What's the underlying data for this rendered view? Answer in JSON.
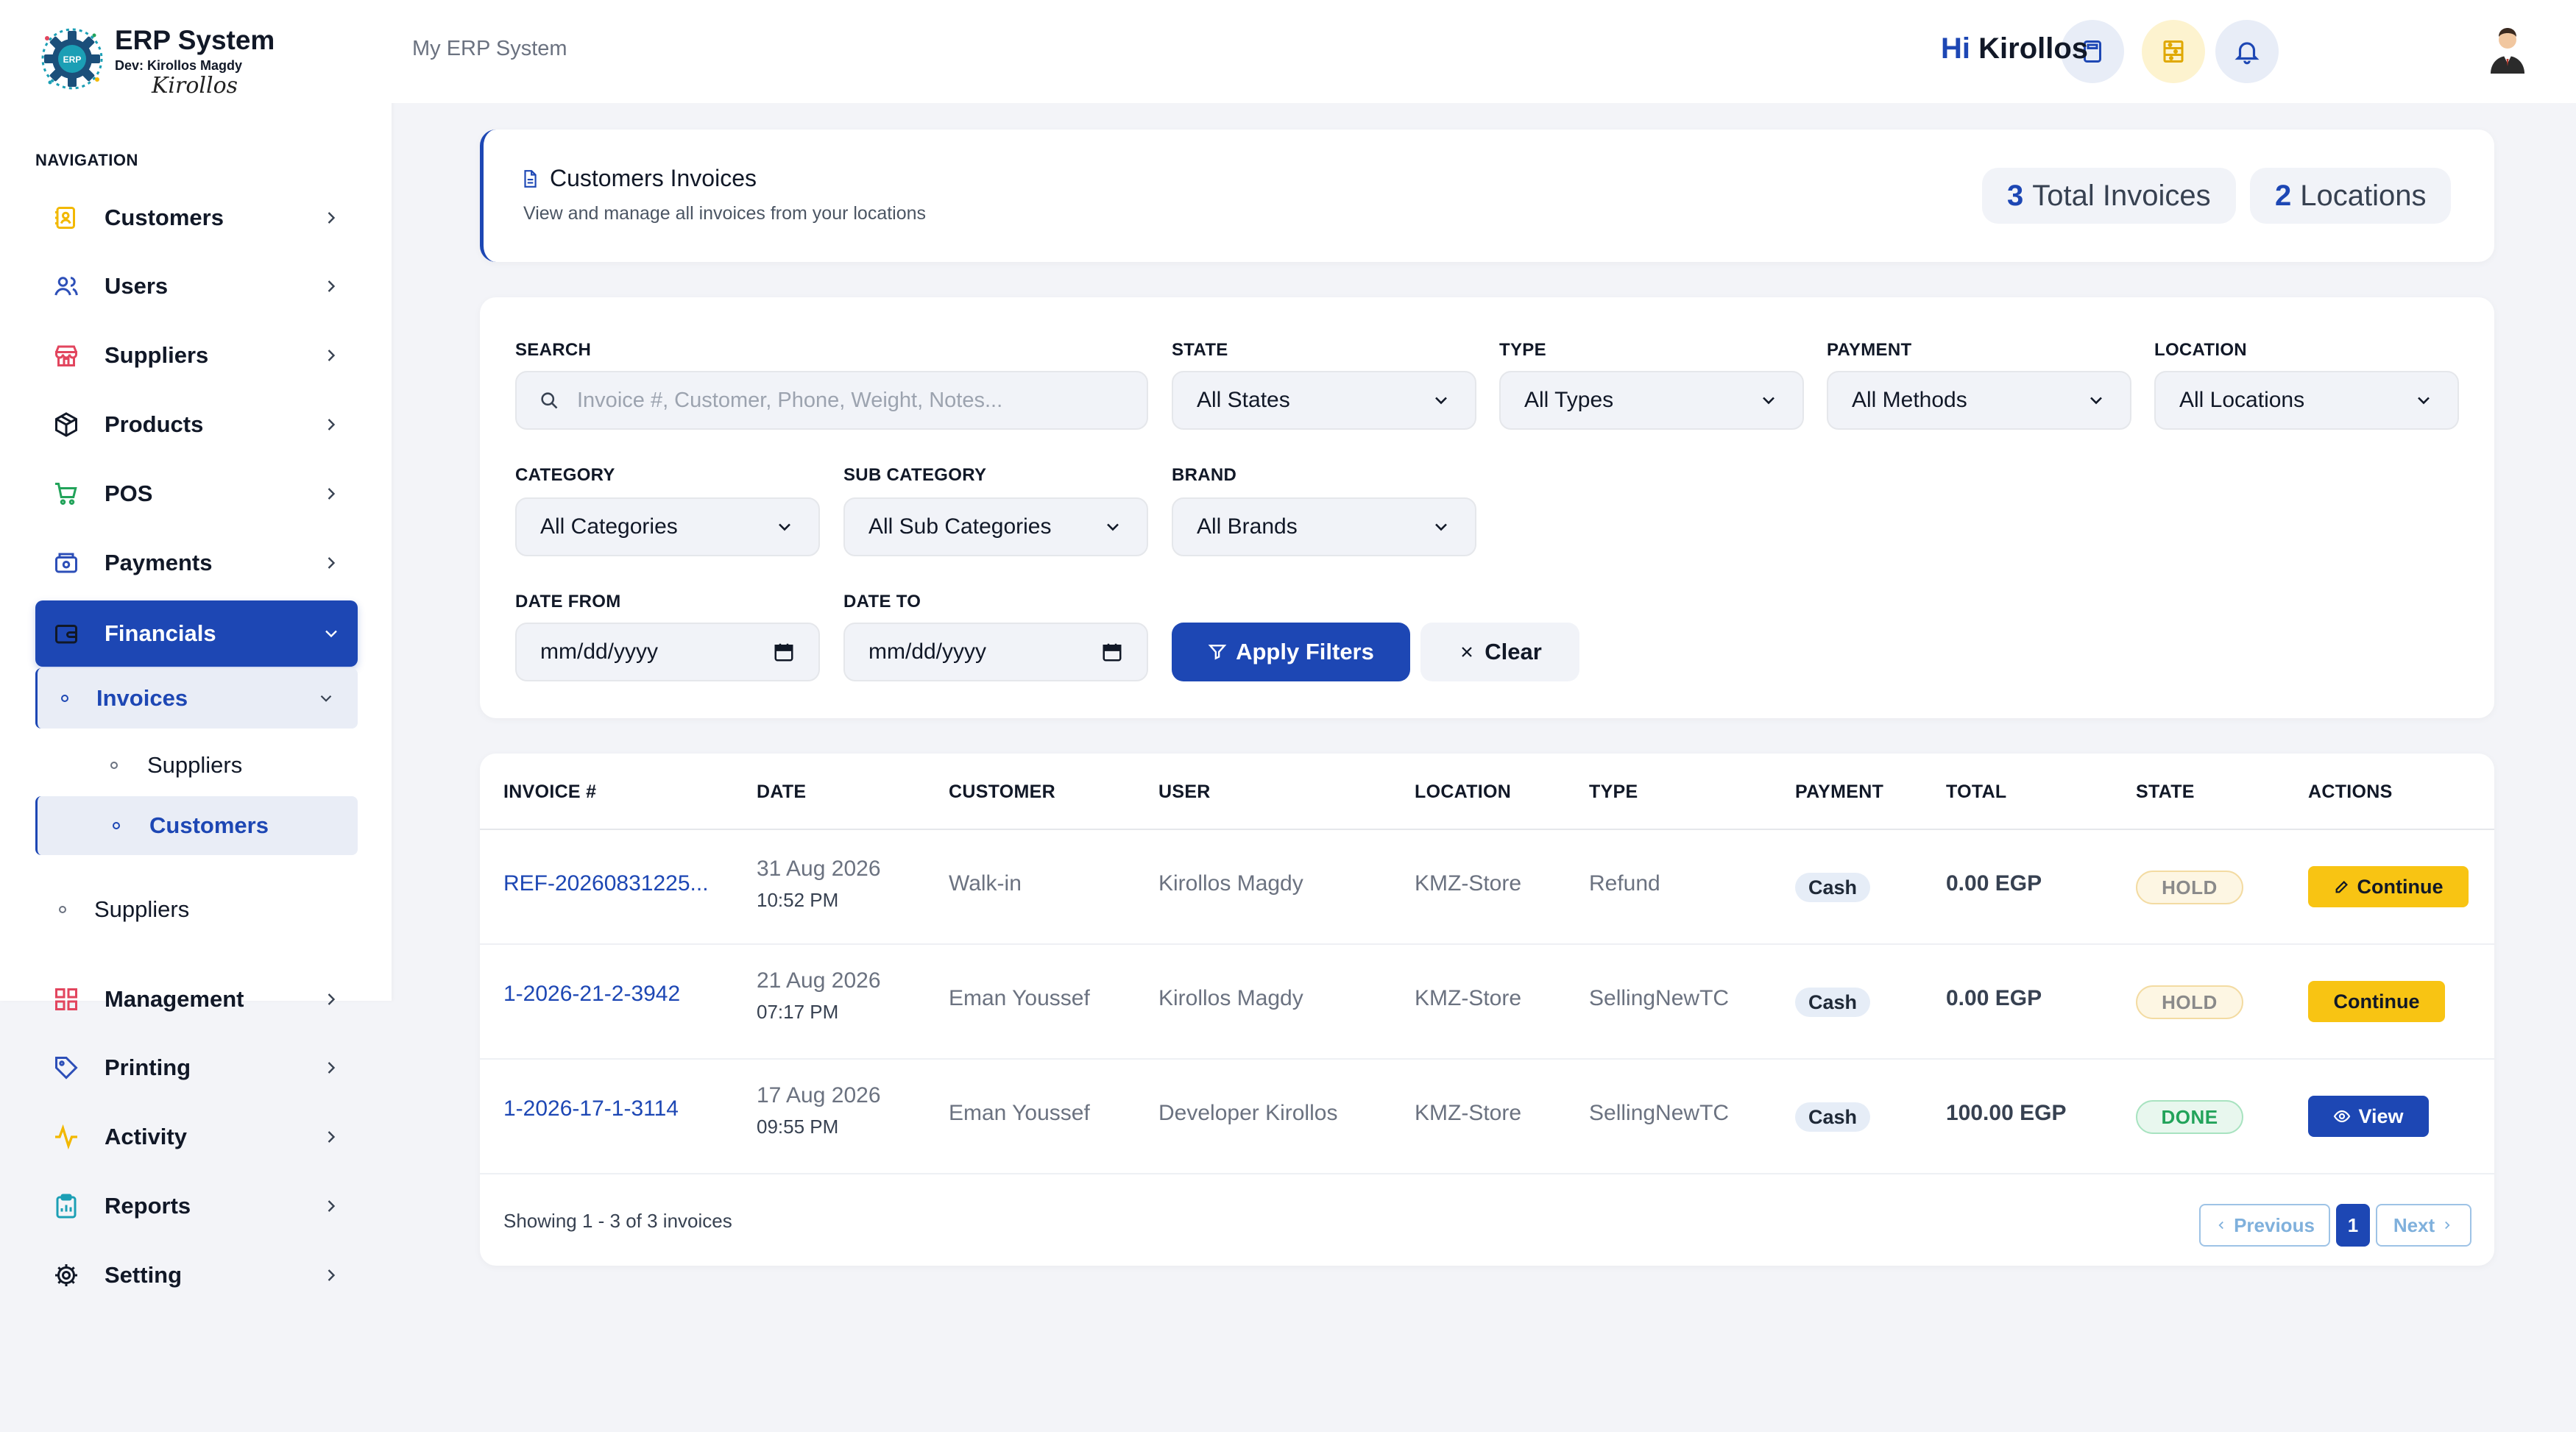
{
  "brand": {
    "title": "ERP System",
    "subtitle": "Dev: Kirollos Magdy",
    "signature": "Kirollos",
    "logo_text": "ERP"
  },
  "sidebar": {
    "heading": "NAVIGATION",
    "items": [
      {
        "label": "Customers",
        "icon": "address-book-icon",
        "color": "#f2b800"
      },
      {
        "label": "Users",
        "icon": "users-icon",
        "color": "#2d4fb8"
      },
      {
        "label": "Suppliers",
        "icon": "store-icon",
        "color": "#e2455e"
      },
      {
        "label": "Products",
        "icon": "box-icon",
        "color": "#111827"
      },
      {
        "label": "POS",
        "icon": "cart-icon",
        "color": "#22a35a"
      },
      {
        "label": "Payments",
        "icon": "wallet-icon",
        "color": "#2d4fb8"
      },
      {
        "label": "Financials",
        "icon": "finance-wallet-icon",
        "color": "#111827"
      },
      {
        "label": "Management",
        "icon": "grid-icon",
        "color": "#e2455e"
      },
      {
        "label": "Printing",
        "icon": "tag-icon",
        "color": "#2d4fb8"
      },
      {
        "label": "Activity",
        "icon": "activity-icon",
        "color": "#f2b800"
      },
      {
        "label": "Reports",
        "icon": "clipboard-icon",
        "color": "#1b9fb5"
      },
      {
        "label": "Setting",
        "icon": "gear-icon",
        "color": "#111827"
      }
    ],
    "financials_sub": {
      "invoices_label": "Invoices",
      "invoices_children": [
        "Suppliers",
        "Customers"
      ],
      "suppliers_label": "Suppliers"
    }
  },
  "header": {
    "breadcrumb": "My ERP System",
    "greeting_hi": "Hi",
    "user_name": "Kirollos"
  },
  "page": {
    "title": "Customers Invoices",
    "subtitle": "View and manage all invoices from your locations",
    "total_invoices_count": "3",
    "total_invoices_label": "Total Invoices",
    "locations_count": "2",
    "locations_label": "Locations"
  },
  "filters": {
    "search_label": "SEARCH",
    "search_placeholder": "Invoice #, Customer, Phone, Weight, Notes...",
    "state_label": "STATE",
    "state_value": "All States",
    "type_label": "TYPE",
    "type_value": "All Types",
    "payment_label": "PAYMENT",
    "payment_value": "All Methods",
    "location_label": "LOCATION",
    "location_value": "All Locations",
    "category_label": "CATEGORY",
    "category_value": "All Categories",
    "subcategory_label": "SUB CATEGORY",
    "subcategory_value": "All Sub Categories",
    "brand_label": "BRAND",
    "brand_value": "All Brands",
    "date_from_label": "DATE FROM",
    "date_from_value": "mm/dd/yyyy",
    "date_to_label": "DATE TO",
    "date_to_value": "mm/dd/yyyy",
    "apply_label": "Apply Filters",
    "clear_label": "Clear"
  },
  "table": {
    "headers": [
      "INVOICE #",
      "DATE",
      "CUSTOMER",
      "USER",
      "LOCATION",
      "TYPE",
      "PAYMENT",
      "TOTAL",
      "STATE",
      "ACTIONS"
    ],
    "rows": [
      {
        "invoice": "REF-20260831225...",
        "date": "31 Aug 2026",
        "time": "10:52 PM",
        "customer": "Walk-in",
        "user": "Kirollos Magdy",
        "location": "KMZ-Store",
        "type": "Refund",
        "payment": "Cash",
        "total": "0.00 EGP",
        "state": "HOLD",
        "action": "Continue"
      },
      {
        "invoice": "1-2026-21-2-3942",
        "date": "21 Aug 2026",
        "time": "07:17 PM",
        "customer": "Eman Youssef",
        "user": "Kirollos Magdy",
        "location": "KMZ-Store",
        "type": "SellingNewTC",
        "payment": "Cash",
        "total": "0.00 EGP",
        "state": "HOLD",
        "action": "Continue"
      },
      {
        "invoice": "1-2026-17-1-3114",
        "date": "17 Aug 2026",
        "time": "09:55 PM",
        "customer": "Eman Youssef",
        "user": "Developer Kirollos",
        "location": "KMZ-Store",
        "type": "SellingNewTC",
        "payment": "Cash",
        "total": "100.00 EGP",
        "state": "DONE",
        "action": "View"
      }
    ],
    "showing": "Showing 1 - 3 of 3 invoices",
    "prev_label": "Previous",
    "next_label": "Next",
    "current_page": "1"
  },
  "colors": {
    "accent": "#1d47b4",
    "warning": "#f8c413",
    "success": "#22a35a"
  }
}
